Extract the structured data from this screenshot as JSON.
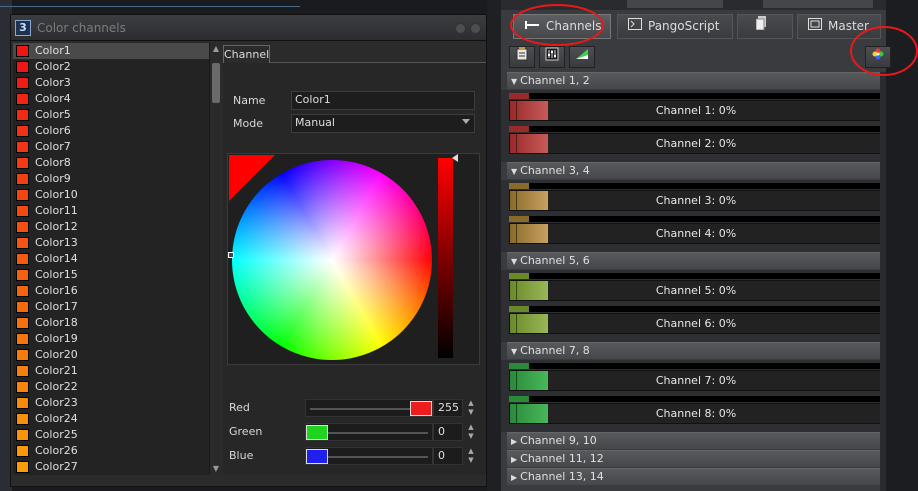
{
  "dialog": {
    "title": "Color channels",
    "app_icon": "3",
    "tab_label": "Channel",
    "name_label": "Name",
    "name_value": "Color1",
    "mode_label": "Mode",
    "mode_value": "Manual",
    "sliders": [
      {
        "label": "Red",
        "value": "255",
        "level": 1.0,
        "color": "#ee1c1c"
      },
      {
        "label": "Green",
        "value": "0",
        "level": 0.0,
        "color": "#1ed41e"
      },
      {
        "label": "Blue",
        "value": "0",
        "level": 0.0,
        "color": "#2020ee"
      }
    ],
    "colors": [
      {
        "label": "Color1",
        "swatch": "#f01616"
      },
      {
        "label": "Color2",
        "swatch": "#f01616"
      },
      {
        "label": "Color3",
        "swatch": "#f11b15"
      },
      {
        "label": "Color4",
        "swatch": "#f22514"
      },
      {
        "label": "Color5",
        "swatch": "#f22a14"
      },
      {
        "label": "Color6",
        "swatch": "#f23013"
      },
      {
        "label": "Color7",
        "swatch": "#f33513"
      },
      {
        "label": "Color8",
        "swatch": "#f33a12"
      },
      {
        "label": "Color9",
        "swatch": "#f34012"
      },
      {
        "label": "Color10",
        "swatch": "#f44511"
      },
      {
        "label": "Color11",
        "swatch": "#f44a11"
      },
      {
        "label": "Color12",
        "swatch": "#f45010"
      },
      {
        "label": "Color13",
        "swatch": "#f55510"
      },
      {
        "label": "Color14",
        "swatch": "#f55a0f"
      },
      {
        "label": "Color15",
        "swatch": "#f5600f"
      },
      {
        "label": "Color16",
        "swatch": "#f6650e"
      },
      {
        "label": "Color17",
        "swatch": "#f66a0e"
      },
      {
        "label": "Color18",
        "swatch": "#f6700d"
      },
      {
        "label": "Color19",
        "swatch": "#f7750d"
      },
      {
        "label": "Color20",
        "swatch": "#f77a0c"
      },
      {
        "label": "Color21",
        "swatch": "#f77f0c"
      },
      {
        "label": "Color22",
        "swatch": "#f8840b"
      },
      {
        "label": "Color23",
        "swatch": "#f8890b"
      },
      {
        "label": "Color24",
        "swatch": "#f88e0a"
      },
      {
        "label": "Color25",
        "swatch": "#f9930a"
      },
      {
        "label": "Color26",
        "swatch": "#f99809"
      },
      {
        "label": "Color27",
        "swatch": "#f99c09"
      }
    ]
  },
  "right_panel": {
    "tabs": [
      {
        "label": "Channels",
        "icon": "slider-icon",
        "active": true
      },
      {
        "label": "PangoScript",
        "icon": "terminal-icon",
        "active": false
      },
      {
        "label": "",
        "icon": "document-icon",
        "active": false
      },
      {
        "label": "Master",
        "icon": "window-icon",
        "active": false
      }
    ],
    "toolbar_icons": [
      "clipboard-icon",
      "equalizer-icon",
      "ramp-icon",
      "color-wheel-icon"
    ],
    "groups": [
      {
        "header": "Channel 1, 2",
        "expanded": true,
        "color": "#9a2a2a",
        "thumb": "#c85a5a",
        "channels": [
          {
            "label": "Channel 1: 0%",
            "level": 0
          },
          {
            "label": "Channel 2: 0%",
            "level": 0
          }
        ]
      },
      {
        "header": "Channel 3, 4",
        "expanded": true,
        "color": "#8a6a2a",
        "thumb": "#c8a060",
        "channels": [
          {
            "label": "Channel 3: 0%",
            "level": 0
          },
          {
            "label": "Channel 4: 0%",
            "level": 0
          }
        ]
      },
      {
        "header": "Channel 5, 6",
        "expanded": true,
        "color": "#6a8a2a",
        "thumb": "#98b858",
        "channels": [
          {
            "label": "Channel 5: 0%",
            "level": 0
          },
          {
            "label": "Channel 6: 0%",
            "level": 0
          }
        ]
      },
      {
        "header": "Channel 7, 8",
        "expanded": true,
        "color": "#2a8a3a",
        "thumb": "#48b85a",
        "channels": [
          {
            "label": "Channel 7: 0%",
            "level": 0
          },
          {
            "label": "Channel 8: 0%",
            "level": 0
          }
        ]
      },
      {
        "header": "Channel 9, 10",
        "expanded": false
      },
      {
        "header": "Channel 11, 12",
        "expanded": false
      },
      {
        "header": "Channel 13, 14",
        "expanded": false
      }
    ]
  }
}
